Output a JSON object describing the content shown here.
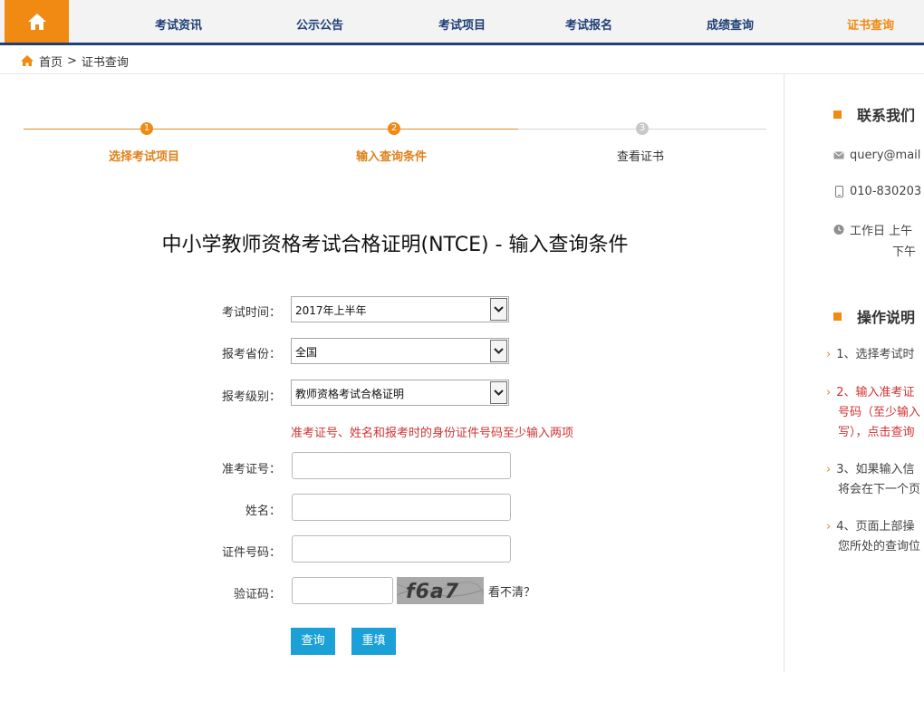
{
  "nav": {
    "items": [
      "考试资讯",
      "公示公告",
      "考试项目",
      "考试报名",
      "成绩查询",
      "证书查询"
    ],
    "active_index": 5,
    "accent_color": "#f08a12",
    "nav_color": "#1f3f77"
  },
  "breadcrumb": {
    "home": "首页",
    "separator": ">",
    "current": "证书查询"
  },
  "steps": [
    {
      "num": "1",
      "label": "选择考试项目",
      "state": "done"
    },
    {
      "num": "2",
      "label": "输入查询条件",
      "state": "done"
    },
    {
      "num": "3",
      "label": "查看证书",
      "state": "todo"
    }
  ],
  "page_title": "中小学教师资格考试合格证明(NTCE) - 输入查询条件",
  "form": {
    "exam_time": {
      "label": "考试时间：",
      "value": "2017年上半年"
    },
    "province": {
      "label": "报考省份：",
      "value": "全国"
    },
    "level": {
      "label": "报考级别：",
      "value": "教师资格考试合格证明"
    },
    "hint": "准考证号、姓名和报考时的身份证件号码至少输入两项",
    "ticket_no": {
      "label": "准考证号：",
      "value": ""
    },
    "name": {
      "label": "姓名：",
      "value": ""
    },
    "id_no": {
      "label": "证件号码：",
      "value": ""
    },
    "captcha": {
      "label": "验证码：",
      "value": "",
      "image_text": "f6a7",
      "refresh": "看不清？"
    },
    "submit": "查询",
    "reset": "重填"
  },
  "sidebar": {
    "contact_title": "联系我们",
    "email": "query@mail",
    "phone": "010-830203",
    "hours_line1": "工作日 上午",
    "hours_line2": "下午",
    "help_title": "操作说明",
    "instructions": [
      {
        "lines": [
          "1、选择考试时"
        ],
        "color": "gray"
      },
      {
        "lines": [
          "2、输入准考证",
          "号码（至少输入",
          "写），点击查询"
        ],
        "color": "red"
      },
      {
        "lines": [
          "3、如果输入信",
          "将会在下一个页"
        ],
        "color": "gray"
      },
      {
        "lines": [
          "4、页面上部操",
          "您所处的查询位"
        ],
        "color": "gray"
      }
    ]
  }
}
